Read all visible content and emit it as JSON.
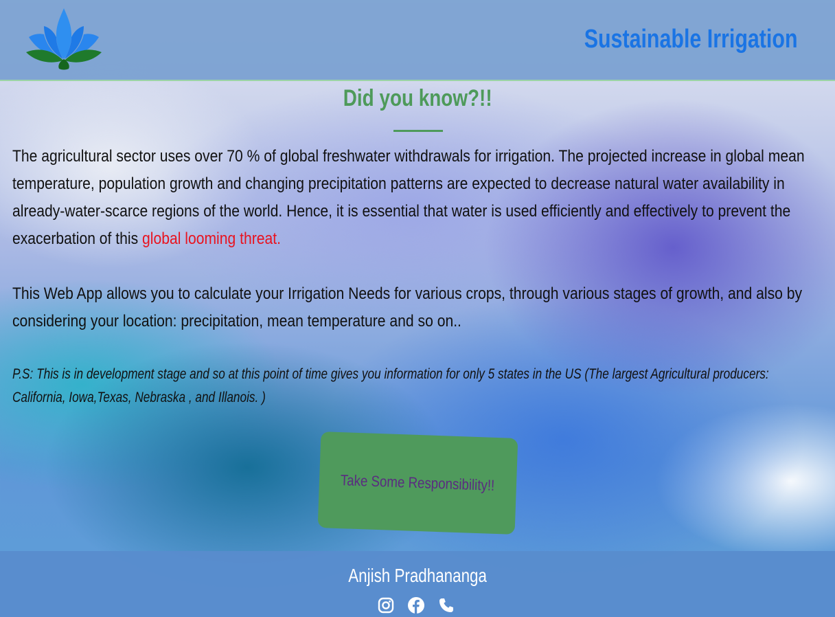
{
  "header": {
    "logo_icon": "lotus-icon",
    "title": "Sustainable Irrigation"
  },
  "main": {
    "heading": "Did you know?!!",
    "paragraph1_text": "The agricultural sector uses over 70 % of global freshwater withdrawals for irrigation. The projected increase in global mean temperature, population growth and changing precipitation patterns are expected to decrease natural water availability in already-water-scarce regions of the world. Hence, it is essential that water is used efficiently and effectively to prevent the exacerbation of this ",
    "paragraph1_highlight": "global looming threat.",
    "paragraph2": "This Web App allows you to calculate your Irrigation Needs for various crops, through various stages of growth, and also by considering your location: precipitation, mean temperature and so on..",
    "note": "P.S: This is in development stage and so at this point of time gives you information for only 5 states in the US (The largest Agricultural producers: California, Iowa,Texas, Nebraska , and Illanois. )",
    "cta_label": "Take Some Responsibility!!"
  },
  "footer": {
    "author": "Anjish Pradhananga",
    "social_icons": [
      "instagram-icon",
      "facebook-icon",
      "phone-icon"
    ]
  },
  "colors": {
    "header_bg": "#78a0d0",
    "title": "#1a74e4",
    "heading": "#4e9a5a",
    "highlight": "#e8131f",
    "cta_bg": "#4f9a5c",
    "cta_text": "#5a2c80",
    "footer_bg": "#588ccd"
  }
}
